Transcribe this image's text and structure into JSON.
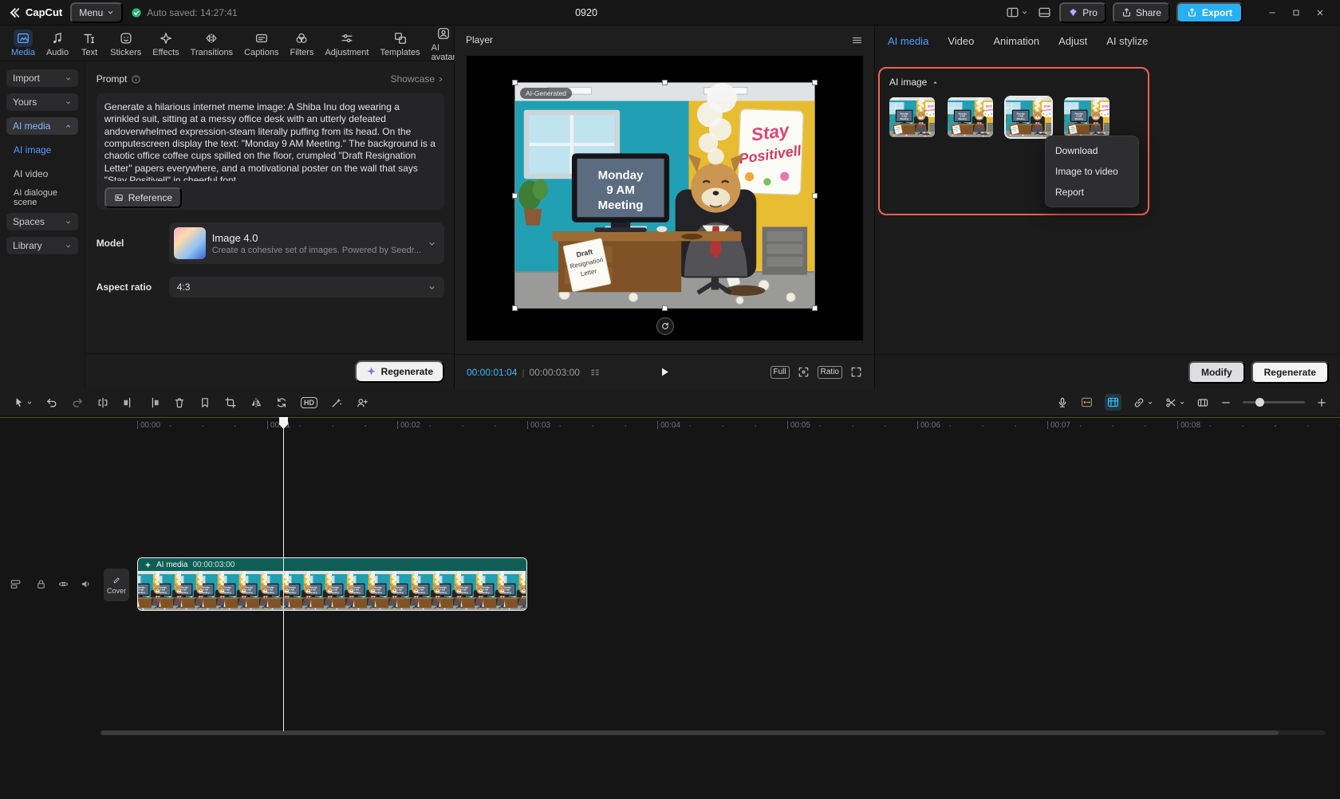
{
  "colors": {
    "accent_blue": "#4c9fff",
    "export_cyan": "#27b0f4",
    "highlight_red": "#f4604f",
    "clip_teal": "#0f5e55",
    "timecode_cyan": "#3db8f5",
    "autosave_green": "#2cb879"
  },
  "titlebar": {
    "app_name": "CapCut",
    "menu_label": "Menu",
    "autosave_text": "Auto saved: 14:27:41",
    "project_title": "0920",
    "pro_label": "Pro",
    "share_label": "Share",
    "export_label": "Export"
  },
  "toolbar": {
    "active": "Media",
    "items": [
      {
        "label": "Media"
      },
      {
        "label": "Audio"
      },
      {
        "label": "Text"
      },
      {
        "label": "Stickers"
      },
      {
        "label": "Effects"
      },
      {
        "label": "Transitions"
      },
      {
        "label": "Captions"
      },
      {
        "label": "Filters"
      },
      {
        "label": "Adjustment"
      },
      {
        "label": "Templates"
      },
      {
        "label": "AI avatar"
      }
    ]
  },
  "sidebar": {
    "active_section": "AI media",
    "active_item": "AI image",
    "items": [
      {
        "label": "Import"
      },
      {
        "label": "Yours"
      },
      {
        "label": "AI media"
      },
      {
        "label": "AI image"
      },
      {
        "label": "AI video"
      },
      {
        "label": "AI dialogue scene"
      },
      {
        "label": "Spaces"
      },
      {
        "label": "Library"
      }
    ]
  },
  "prompt_panel": {
    "title": "Prompt",
    "showcase_label": "Showcase",
    "prompt_text": "Generate a hilarious internet meme image: A Shiba Inu dog wearing a wrinkled suit, sitting at a messy office desk with an utterly defeated andoverwhelmed expression-steam literally puffing from its head. On the computescreen display the text: \"Monday 9 AM Meeting.\" The background is a chaotic office coffee cups spilled on the floor, crumpled \"Draft Resignation Letter\" papers everywhere, and a motivational poster on the wall that says \"Stay Positivell\" in cheerful font.",
    "reference_label": "Reference",
    "model_label": "Model",
    "model_name": "Image 4.0",
    "model_desc": "Create a cohesive set of images. Powered by Seedr...",
    "aspect_label": "Aspect ratio",
    "aspect_value": "4:3",
    "regenerate_label": "Regenerate"
  },
  "player": {
    "title": "Player",
    "current_time": "00:00:01:04",
    "duration": "00:00:03:00",
    "full_label": "Full",
    "ratio_label": "Ratio",
    "watermark": "AI-Generated"
  },
  "scene": {
    "monitor_lines": [
      "Monday",
      "9 AM",
      "Meeting"
    ],
    "poster_lines": [
      "Stay",
      "Positivell"
    ],
    "paper_lines": [
      "Draft",
      "Resignation",
      "Letter"
    ]
  },
  "right_panel": {
    "active_tab": "AI media",
    "tabs": [
      {
        "label": "AI media"
      },
      {
        "label": "Video"
      },
      {
        "label": "Animation"
      },
      {
        "label": "Adjust"
      },
      {
        "label": "AI stylize"
      }
    ],
    "section_label": "AI image",
    "thumbnails": [
      {
        "selected": false
      },
      {
        "selected": false
      },
      {
        "selected": true
      },
      {
        "selected": false
      }
    ],
    "context_menu": [
      {
        "label": "Download"
      },
      {
        "label": "Image to video"
      },
      {
        "label": "Report"
      }
    ],
    "modify_label": "Modify",
    "regenerate_label": "Regenerate"
  },
  "timeline": {
    "ruler_labels": [
      "00:00",
      "00:01",
      "00:02",
      "00:03",
      "00:04",
      "00:05",
      "00:06",
      "00:07",
      "00:08"
    ],
    "clip": {
      "label": "AI media",
      "duration": "00:00:03:00"
    },
    "cover_label": "Cover",
    "hd_label": "HD"
  }
}
